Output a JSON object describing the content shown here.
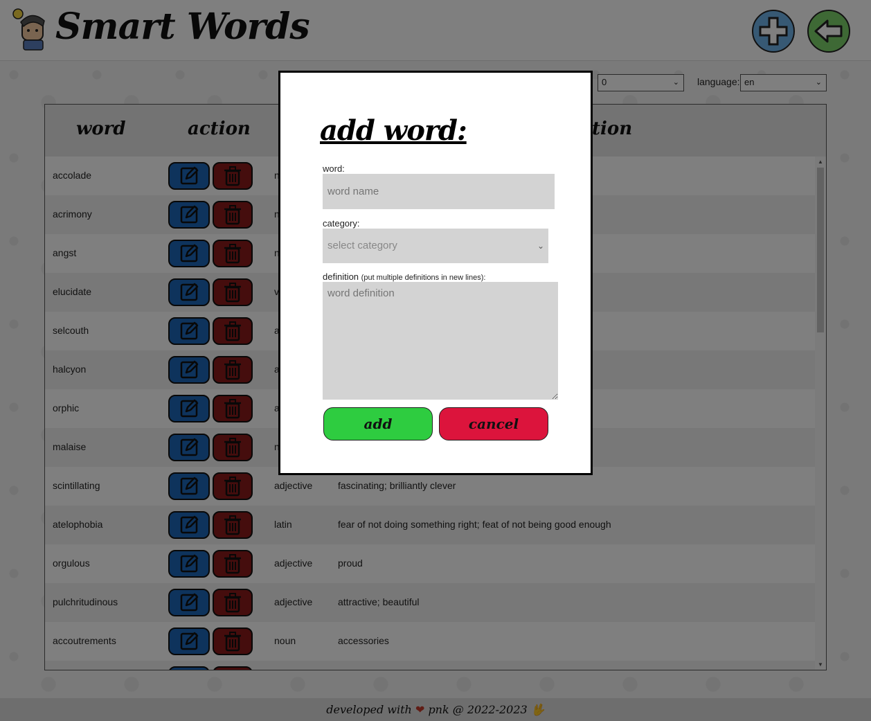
{
  "app": {
    "title": "Smart Words"
  },
  "header": {
    "add_icon": "plus-icon",
    "back_icon": "arrow-left-icon"
  },
  "filters": {
    "count_value": "0",
    "language_label": "language:",
    "language_value": "en"
  },
  "table": {
    "headers": {
      "word": "word",
      "action": "action",
      "definition_partial": "tion"
    },
    "rows": [
      {
        "word": "accolade",
        "category": "n",
        "definition": ""
      },
      {
        "word": "acrimony",
        "category": "n",
        "definition": ""
      },
      {
        "word": "angst",
        "category": "n",
        "definition": ""
      },
      {
        "word": "elucidate",
        "category": "v",
        "definition": ""
      },
      {
        "word": "selcouth",
        "category": "a",
        "definition": ""
      },
      {
        "word": "halcyon",
        "category": "a",
        "definition": ""
      },
      {
        "word": "orphic",
        "category": "a",
        "definition": ""
      },
      {
        "word": "malaise",
        "category": "n",
        "definition": ""
      },
      {
        "word": "scintillating",
        "category": "adjective",
        "definition": "fascinating; brilliantly clever"
      },
      {
        "word": "atelophobia",
        "category": "latin",
        "definition": "fear of not doing something right; feat of not being good enough"
      },
      {
        "word": "orgulous",
        "category": "adjective",
        "definition": "proud"
      },
      {
        "word": "pulchritudinous",
        "category": "adjective",
        "definition": "attractive; beautiful"
      },
      {
        "word": "accoutrements",
        "category": "noun",
        "definition": "accessories"
      }
    ],
    "edit_icon": "edit-icon",
    "delete_icon": "trash-icon"
  },
  "modal": {
    "title": "add word:",
    "word_label": "word:",
    "word_placeholder": "word name",
    "category_label": "category:",
    "category_placeholder": "select category",
    "definition_label": "definition",
    "definition_hint": "(put multiple definitions in new lines):",
    "definition_placeholder": "word definition",
    "add_label": "add",
    "cancel_label": "cancel"
  },
  "footer": {
    "prefix": "developed with",
    "suffix": "pnk @ 2022-2023",
    "heart": "❤",
    "hand": "🖖"
  },
  "colors": {
    "add_button": "#2ecc40",
    "cancel_button": "#dc143c",
    "edit_button": "#1d67b8",
    "delete_button": "#8a1a1a"
  }
}
